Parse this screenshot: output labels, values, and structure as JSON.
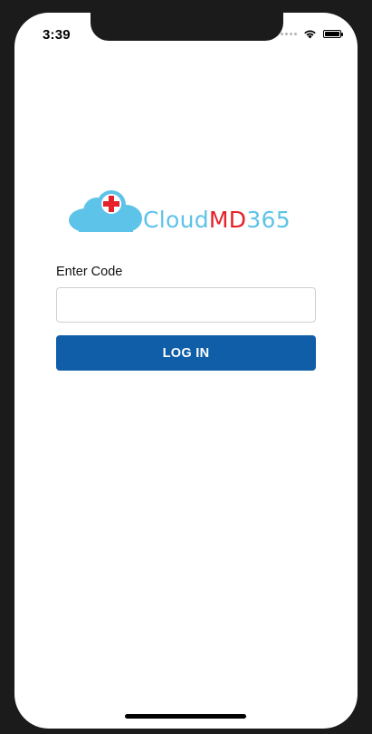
{
  "status_bar": {
    "time": "3:39",
    "icons": [
      "signal-dots-icon",
      "wifi-icon",
      "battery-icon"
    ]
  },
  "logo": {
    "text_part1": "Cloud",
    "text_part2": "MD",
    "text_part3": "365",
    "colors": {
      "cloud": "#5ec3e8",
      "accent": "#e52129"
    }
  },
  "form": {
    "code_label": "Enter Code",
    "code_value": "",
    "login_label": "LOG IN",
    "button_color": "#105ea8"
  }
}
